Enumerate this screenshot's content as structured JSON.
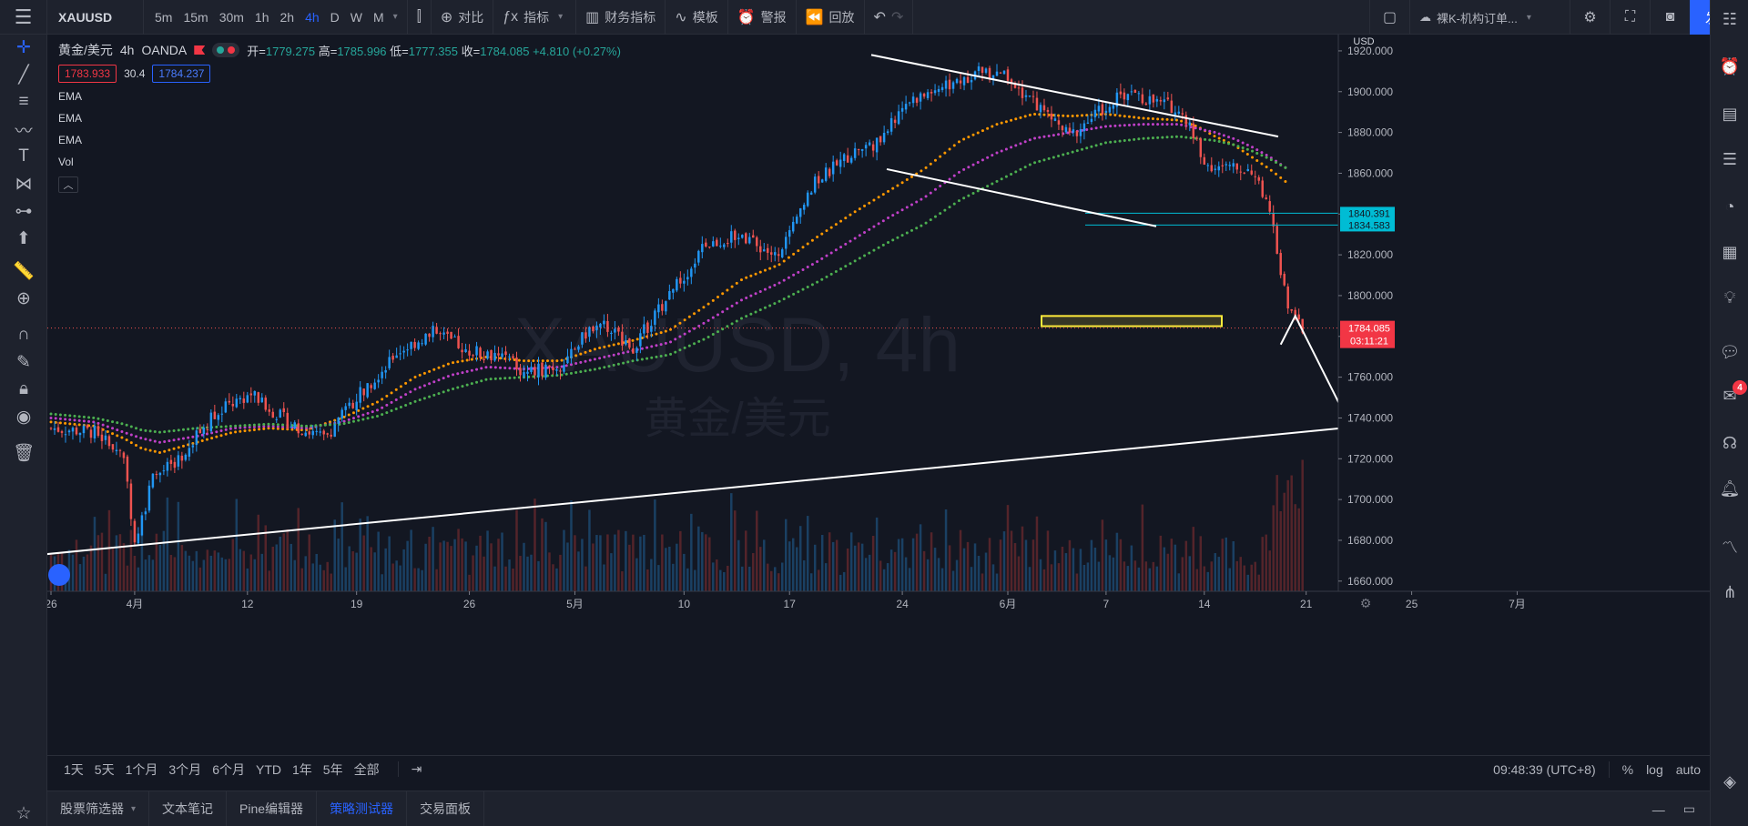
{
  "toolbar": {
    "symbol": "XAUUSD",
    "intervals": [
      "5m",
      "15m",
      "30m",
      "1h",
      "2h",
      "4h",
      "D",
      "W",
      "M"
    ],
    "active_interval": "4h",
    "compare_label": "对比",
    "indicators_label": "指标",
    "financials_label": "财务指标",
    "templates_label": "模板",
    "alert_label": "警报",
    "replay_label": "回放",
    "layout_name": "裸K-机构订单...",
    "publish_label": "发表"
  },
  "legend": {
    "symbol_name": "黄金/美元",
    "interval": "4h",
    "source": "OANDA",
    "open_label": "开=",
    "open": "1779.275",
    "high_label": "高=",
    "high": "1785.996",
    "low_label": "低=",
    "low": "1777.355",
    "close_label": "收=",
    "close": "1784.085",
    "change": "+4.810 (+0.27%)",
    "sell_price": "1783.933",
    "spread": "30.4",
    "buy_price": "1784.237",
    "indicators": [
      "EMA",
      "EMA",
      "EMA",
      "Vol"
    ]
  },
  "watermark": {
    "line1": "XAUUSD, 4h",
    "line2": "黄金/美元"
  },
  "price_axis": {
    "currency": "USD",
    "current_price": "1784.085",
    "countdown": "03:11:21",
    "level_a": "1840.391",
    "level_b": "1834.583"
  },
  "time_axis_labels": [
    "26",
    "4月",
    "12",
    "19",
    "26",
    "5月",
    "10",
    "17",
    "24",
    "6月",
    "7",
    "14",
    "21",
    "25",
    "7月"
  ],
  "range_buttons": [
    "1天",
    "5天",
    "1个月",
    "3个月",
    "6个月",
    "YTD",
    "1年",
    "5年",
    "全部"
  ],
  "clock": "09:48:39 (UTC+8)",
  "scale_options": [
    "%",
    "log",
    "auto"
  ],
  "bottom_tabs": [
    "股票筛选器",
    "文本笔记",
    "Pine编辑器",
    "策略测试器",
    "交易面板"
  ],
  "active_bottom_tab": "策略测试器",
  "notification_count": "4",
  "colors": {
    "up": "#2196f3",
    "down": "#ef5350",
    "ema_fast": "#ff9800",
    "ema_mid": "#c040c8",
    "ema_slow": "#4caf50",
    "accent": "#2962ff",
    "zone": "#ffeb3b"
  },
  "chart_data": {
    "type": "line",
    "title": "黄金/美元",
    "xlabel": "",
    "ylabel": "",
    "ylim": [
      1655,
      1928
    ],
    "y_ticks": [
      1660,
      1680,
      1700,
      1720,
      1740,
      1760,
      1780,
      1800,
      1820,
      1840,
      1860,
      1880,
      1900,
      1920
    ],
    "x_tick_indices": [
      0,
      23,
      54,
      84,
      115,
      144,
      174,
      203,
      234,
      263,
      290,
      317,
      345,
      374,
      403
    ],
    "x_index_range": [
      0,
      440
    ],
    "series": [
      {
        "name": "",
        "x": [
          0,
          12,
          20,
          23,
          28,
          35,
          45,
          55,
          65,
          75,
          85,
          95,
          105,
          115,
          125,
          130,
          140,
          150,
          160,
          170,
          180,
          190,
          200,
          210,
          220,
          228,
          235,
          245,
          255,
          262,
          270,
          280,
          290,
          296,
          303,
          310,
          318,
          325,
          330,
          335,
          340,
          344
        ],
        "y": [
          1735,
          1733,
          1722,
          1679,
          1710,
          1720,
          1742,
          1752,
          1738,
          1730,
          1752,
          1772,
          1782,
          1773,
          1770,
          1762,
          1766,
          1788,
          1775,
          1800,
          1825,
          1830,
          1818,
          1855,
          1870,
          1876,
          1895,
          1902,
          1910,
          1907,
          1895,
          1878,
          1893,
          1900,
          1895,
          1892,
          1864,
          1862,
          1862,
          1840,
          1793,
          1784
        ]
      },
      {
        "name": "EMA",
        "x": [
          0,
          12,
          20,
          25,
          30,
          40,
          50,
          60,
          70,
          80,
          90,
          100,
          110,
          120,
          130,
          140,
          150,
          160,
          170,
          180,
          190,
          200,
          210,
          220,
          230,
          240,
          250,
          260,
          270,
          280,
          290,
          300,
          310,
          315,
          320,
          325,
          330,
          335,
          340
        ],
        "y": [
          1738,
          1736,
          1730,
          1725,
          1723,
          1728,
          1733,
          1735,
          1734,
          1740,
          1748,
          1760,
          1767,
          1770,
          1768,
          1768,
          1774,
          1778,
          1783,
          1795,
          1808,
          1815,
          1828,
          1840,
          1851,
          1862,
          1876,
          1884,
          1889,
          1888,
          1889,
          1887,
          1886,
          1883,
          1878,
          1874,
          1868,
          1862,
          1855
        ]
      },
      {
        "name": "EMA",
        "x": [
          0,
          12,
          20,
          25,
          30,
          40,
          50,
          60,
          70,
          80,
          90,
          100,
          110,
          120,
          130,
          140,
          150,
          160,
          170,
          180,
          190,
          200,
          210,
          220,
          230,
          240,
          250,
          260,
          270,
          280,
          290,
          300,
          310,
          315,
          320,
          325,
          330,
          335,
          340
        ],
        "y": [
          1740,
          1738,
          1733,
          1730,
          1728,
          1731,
          1735,
          1736,
          1735,
          1738,
          1744,
          1754,
          1761,
          1765,
          1764,
          1765,
          1769,
          1773,
          1777,
          1787,
          1798,
          1806,
          1816,
          1827,
          1838,
          1848,
          1861,
          1870,
          1877,
          1880,
          1883,
          1884,
          1884,
          1882,
          1880,
          1877,
          1873,
          1868,
          1862
        ]
      },
      {
        "name": "EMA",
        "x": [
          0,
          12,
          20,
          25,
          30,
          40,
          50,
          60,
          70,
          80,
          90,
          100,
          110,
          120,
          130,
          140,
          150,
          160,
          170,
          180,
          190,
          200,
          210,
          220,
          230,
          240,
          250,
          260,
          270,
          280,
          290,
          300,
          310,
          315,
          320,
          325,
          330,
          335,
          340
        ],
        "y": [
          1742,
          1740,
          1737,
          1734,
          1733,
          1735,
          1736,
          1737,
          1736,
          1737,
          1741,
          1748,
          1754,
          1759,
          1760,
          1761,
          1764,
          1768,
          1771,
          1779,
          1789,
          1797,
          1806,
          1816,
          1826,
          1835,
          1847,
          1856,
          1865,
          1870,
          1875,
          1877,
          1878,
          1877,
          1876,
          1874,
          1871,
          1867,
          1862
        ]
      }
    ]
  }
}
